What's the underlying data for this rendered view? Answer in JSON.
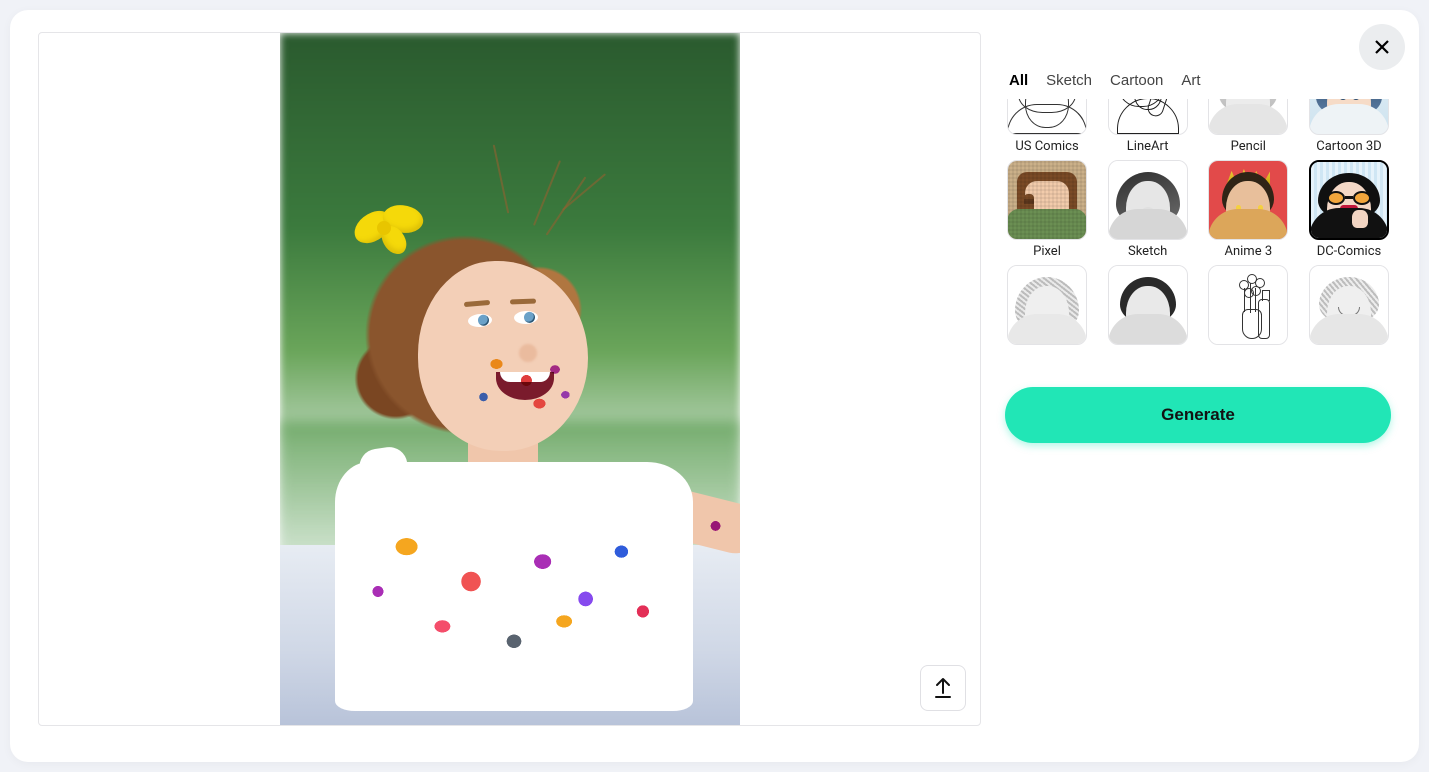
{
  "close_label": "Close",
  "upload_label": "Upload",
  "tabs": [
    {
      "label": "All",
      "active": true
    },
    {
      "label": "Sketch",
      "active": false
    },
    {
      "label": "Cartoon",
      "active": false
    },
    {
      "label": "Art",
      "active": false
    }
  ],
  "styles": [
    {
      "label": "US Comics",
      "selected": false
    },
    {
      "label": "LineArt",
      "selected": false
    },
    {
      "label": "Pencil",
      "selected": false
    },
    {
      "label": "Cartoon 3D",
      "selected": false
    },
    {
      "label": "Pixel",
      "selected": false
    },
    {
      "label": "Sketch",
      "selected": false
    },
    {
      "label": "Anime 3",
      "selected": false
    },
    {
      "label": "DC-Comics",
      "selected": true
    },
    {
      "label": "",
      "selected": false
    },
    {
      "label": "",
      "selected": false
    },
    {
      "label": "",
      "selected": false
    },
    {
      "label": "",
      "selected": false
    }
  ],
  "generate_label": "Generate"
}
